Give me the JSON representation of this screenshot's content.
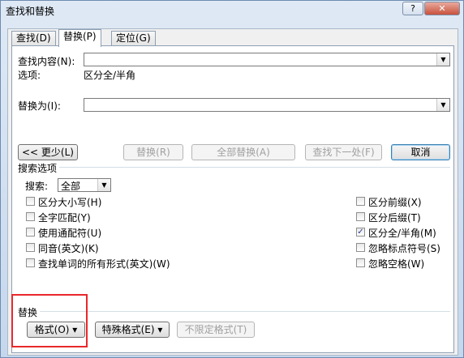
{
  "window": {
    "title": "查找和替换",
    "help_label": "?",
    "close_label": "✕"
  },
  "tabs": [
    {
      "label": "查找(D)"
    },
    {
      "label": "替换(P)"
    },
    {
      "label": "定位(G)"
    }
  ],
  "find": {
    "label": "查找内容(N):",
    "value": "",
    "options_label": "选项:",
    "options_value": "区分全/半角"
  },
  "replace": {
    "label": "替换为(I):",
    "value": ""
  },
  "buttons": {
    "less": "<< 更少(L)",
    "replace": "替换(R)",
    "replace_all": "全部替换(A)",
    "find_next": "查找下一处(F)",
    "cancel": "取消"
  },
  "search_options": {
    "heading": "搜索选项",
    "search_label": "搜索:",
    "search_value": "全部",
    "left": [
      {
        "label": "区分大小写(H)",
        "checked": false
      },
      {
        "label": "全字匹配(Y)",
        "checked": false
      },
      {
        "label": "使用通配符(U)",
        "checked": false
      },
      {
        "label": "同音(英文)(K)",
        "checked": false
      },
      {
        "label": "查找单词的所有形式(英文)(W)",
        "checked": false
      }
    ],
    "right": [
      {
        "label": "区分前缀(X)",
        "checked": false
      },
      {
        "label": "区分后缀(T)",
        "checked": false
      },
      {
        "label": "区分全/半角(M)",
        "checked": true
      },
      {
        "label": "忽略标点符号(S)",
        "checked": false
      },
      {
        "label": "忽略空格(W)",
        "checked": false
      }
    ]
  },
  "replace_section": {
    "heading": "替换",
    "format": "格式(O) ▾",
    "special": "特殊格式(E) ▾",
    "no_format": "不限定格式(T)"
  },
  "colors": {
    "highlight": "#e8282b",
    "check": "#2a3c8f"
  }
}
